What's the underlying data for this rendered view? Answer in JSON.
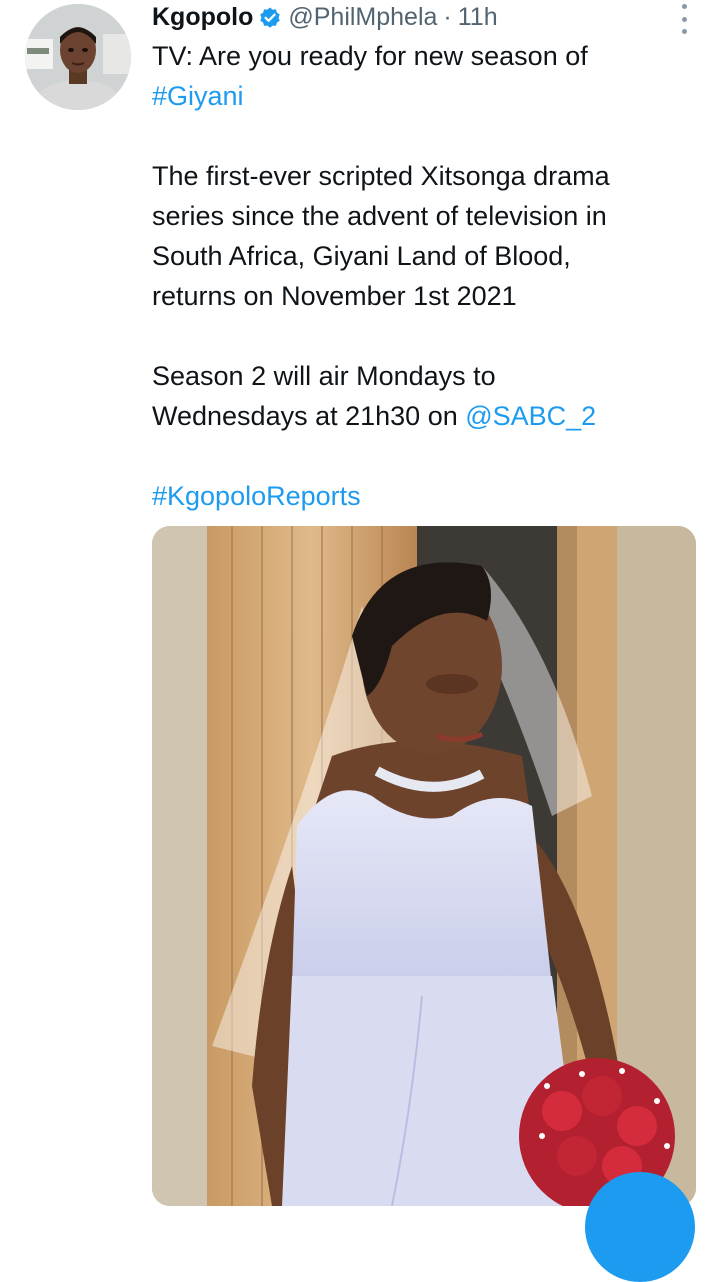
{
  "tweet": {
    "author": {
      "display_name": "Kgopolo",
      "handle": "@PhilMphela",
      "separator": "·",
      "time": "11h"
    },
    "lines": {
      "l1": "TV: Are you ready for new season of",
      "l2_tag": "#Giyani",
      "l3": "The first-ever scripted Xitsonga drama",
      "l4": "series since the advent of television in",
      "l5": "South Africa, Giyani Land of Blood,",
      "l6": "returns on November 1st 2021",
      "l7": "Season 2 will air Mondays to",
      "l8_text": "Wednesdays at 21h30 on ",
      "l8_mention": "@SABC_2",
      "l9_tag": "#KgopoloReports"
    },
    "icons": {
      "verified": "verified-badge-icon",
      "more": "more-options-icon"
    },
    "colors": {
      "link": "#1d9bf0",
      "secondary_text": "#536471",
      "primary_text": "#0f1419"
    }
  }
}
